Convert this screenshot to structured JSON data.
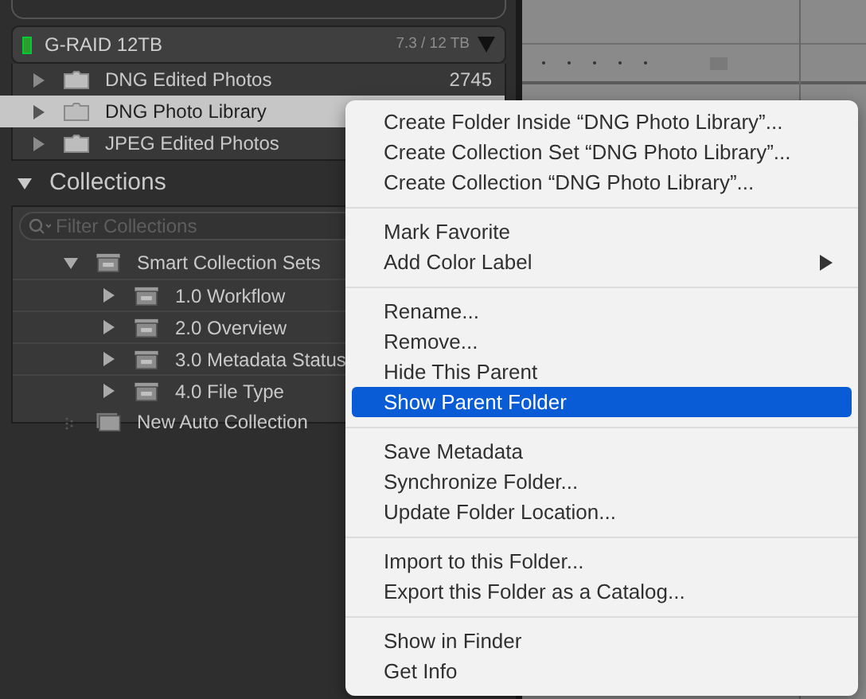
{
  "volume": {
    "name": "G-RAID 12TB",
    "usage": "7.3 / 12 TB",
    "expanded": true
  },
  "folders": [
    {
      "name": "DNG Edited Photos",
      "count": "2745",
      "selected": false
    },
    {
      "name": "DNG Photo Library",
      "selected": true
    },
    {
      "name": "JPEG Edited Photos",
      "selected": false
    }
  ],
  "collections": {
    "title": "Collections",
    "expanded": true,
    "filter_placeholder": "Filter Collections",
    "items": [
      {
        "kind": "set",
        "name": "Smart Collection Sets",
        "expanded": true,
        "children": [
          {
            "kind": "set",
            "name": "1.0 Workflow",
            "expanded": false
          },
          {
            "kind": "set",
            "name": "2.0 Overview",
            "expanded": false
          },
          {
            "kind": "set",
            "name": "3.0 Metadata Status",
            "expanded": false
          },
          {
            "kind": "set",
            "name": "4.0 File Type",
            "expanded": false
          }
        ]
      },
      {
        "kind": "auto",
        "name": "New Auto Collection"
      }
    ]
  },
  "context_menu": {
    "groups": [
      [
        {
          "label": "Create Folder Inside “DNG Photo Library”...",
          "selected": false,
          "submenu": false
        },
        {
          "label": "Create Collection Set “DNG Photo Library”...",
          "selected": false,
          "submenu": false
        },
        {
          "label": "Create Collection “DNG Photo Library”...",
          "selected": false,
          "submenu": false
        }
      ],
      [
        {
          "label": "Mark Favorite",
          "selected": false,
          "submenu": false
        },
        {
          "label": "Add Color Label",
          "selected": false,
          "submenu": true
        }
      ],
      [
        {
          "label": "Rename...",
          "selected": false,
          "submenu": false
        },
        {
          "label": "Remove...",
          "selected": false,
          "submenu": false
        },
        {
          "label": "Hide This Parent",
          "selected": false,
          "submenu": false
        },
        {
          "label": "Show Parent Folder",
          "selected": true,
          "submenu": false
        }
      ],
      [
        {
          "label": "Save Metadata",
          "selected": false,
          "submenu": false
        },
        {
          "label": "Synchronize Folder...",
          "selected": false,
          "submenu": false
        },
        {
          "label": "Update Folder Location...",
          "selected": false,
          "submenu": false
        }
      ],
      [
        {
          "label": "Import to this Folder...",
          "selected": false,
          "submenu": false
        },
        {
          "label": "Export this Folder as a Catalog...",
          "selected": false,
          "submenu": false
        }
      ],
      [
        {
          "label": "Show in Finder",
          "selected": false,
          "submenu": false
        },
        {
          "label": "Get Info",
          "selected": false,
          "submenu": false
        }
      ]
    ]
  }
}
